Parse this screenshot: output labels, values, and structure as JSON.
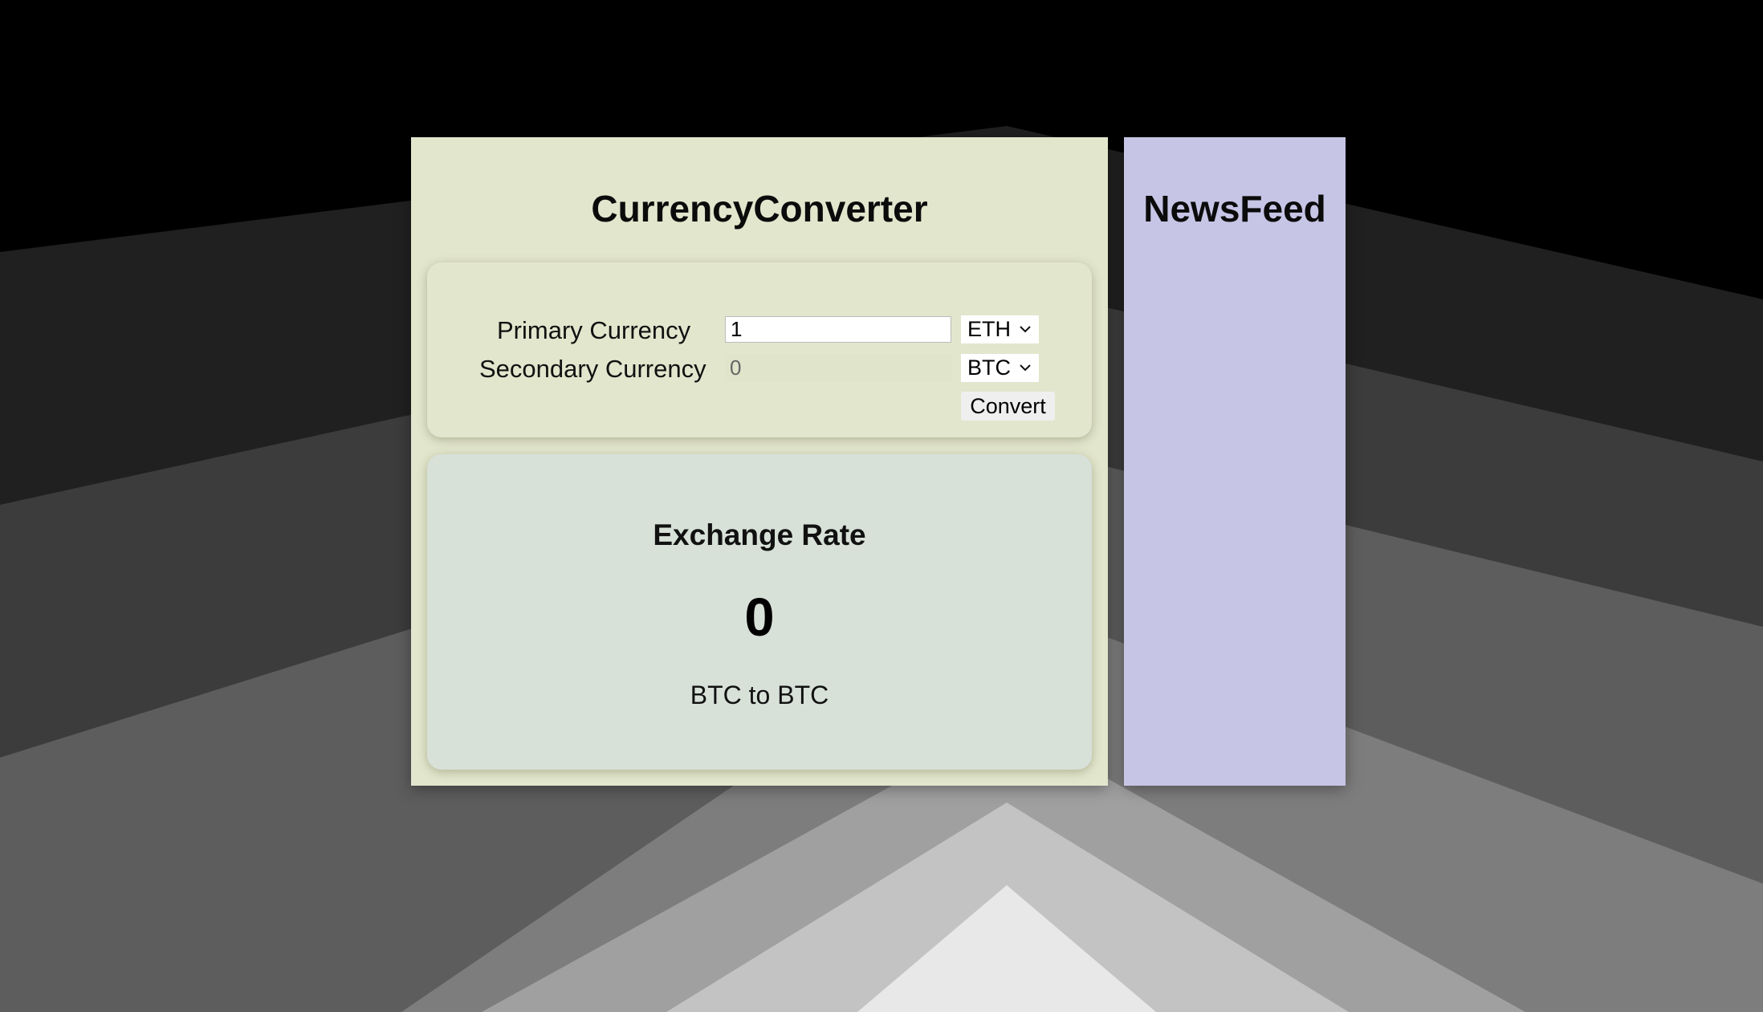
{
  "converter": {
    "title": "CurrencyConverter",
    "primary_label": "Primary Currency",
    "secondary_label": "Secondary Currency",
    "primary_amount": "1",
    "secondary_amount": "0",
    "primary_currency": "ETH",
    "secondary_currency": "BTC",
    "convert_label": "Convert"
  },
  "exchange": {
    "title": "Exchange Rate",
    "value": "0",
    "pair": "BTC to BTC"
  },
  "news": {
    "title": "NewsFeed"
  },
  "colors": {
    "converter_bg": "#e2e6cd",
    "rate_card_bg": "#d7e1d8",
    "news_bg": "#c6c5e5"
  }
}
